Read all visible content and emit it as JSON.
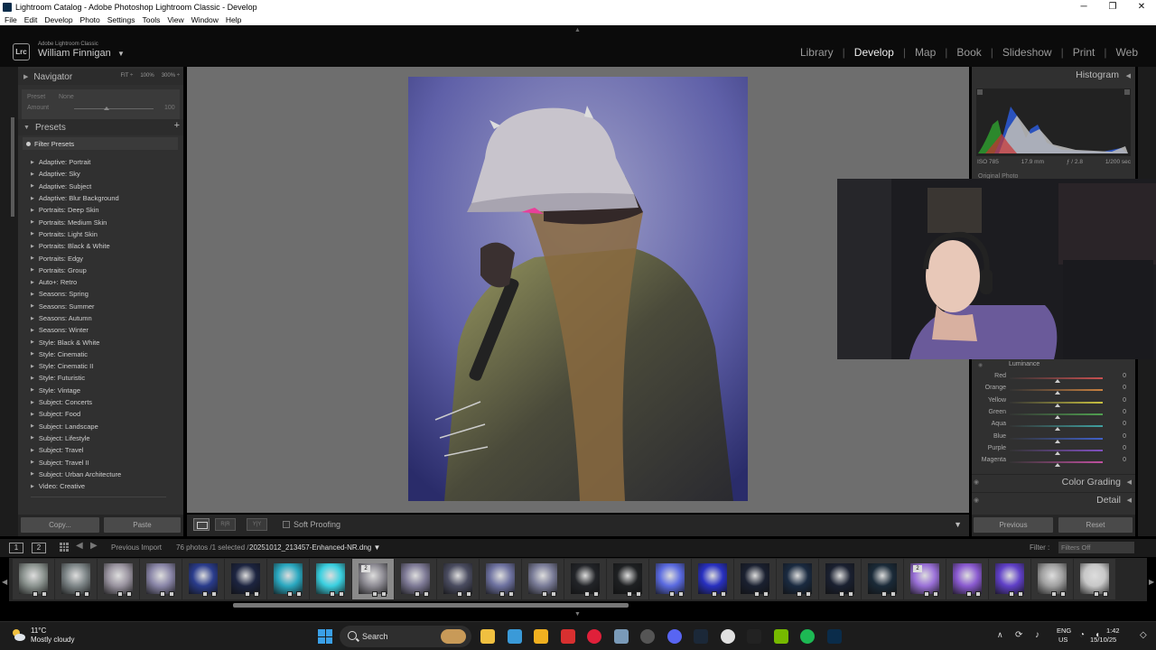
{
  "window": {
    "title": "Lightroom Catalog - Adobe Photoshop Lightroom Classic - Develop",
    "minimize": "─",
    "maximize": "❐",
    "close": "✕"
  },
  "menu": [
    "File",
    "Edit",
    "Develop",
    "Photo",
    "Settings",
    "Tools",
    "View",
    "Window",
    "Help"
  ],
  "identity": {
    "logo": "Lrc",
    "app_name": "Adobe Lightroom Classic",
    "user": "William Finnigan",
    "caret": "▼"
  },
  "modules": [
    "Library",
    "Develop",
    "Map",
    "Book",
    "Slideshow",
    "Print",
    "Web"
  ],
  "active_module": "Develop",
  "navigator": {
    "title": "Navigator",
    "zoom": [
      "FIT ÷",
      "100%",
      "300% ÷"
    ],
    "preset_label": "Preset",
    "preset_value": "None",
    "amount_label": "Amount",
    "amount_value": "100"
  },
  "presets": {
    "title": "Presets",
    "add": "+",
    "filter_label": "Filter Presets",
    "items": [
      "Adaptive: Portrait",
      "Adaptive: Sky",
      "Adaptive: Subject",
      "Adaptive: Blur Background",
      "Portraits: Deep Skin",
      "Portraits: Medium Skin",
      "Portraits: Light Skin",
      "Portraits: Black & White",
      "Portraits: Edgy",
      "Portraits: Group",
      "Auto+: Retro",
      "Seasons: Spring",
      "Seasons: Summer",
      "Seasons: Autumn",
      "Seasons: Winter",
      "Style: Black & White",
      "Style: Cinematic",
      "Style: Cinematic II",
      "Style: Futuristic",
      "Style: Vintage",
      "Subject: Concerts",
      "Subject: Food",
      "Subject: Landscape",
      "Subject: Lifestyle",
      "Subject: Travel",
      "Subject: Travel II",
      "Subject: Urban Architecture",
      "Video: Creative"
    ]
  },
  "left_buttons": {
    "copy": "Copy...",
    "paste": "Paste"
  },
  "toolbar": {
    "soft_proofing": "Soft Proofing",
    "ba": "R|R",
    "yy": "Y|Y",
    "caret": "▼"
  },
  "histogram": {
    "title": "Histogram",
    "exif": [
      "ISO 785",
      "17.9 mm",
      "ƒ / 2.8",
      "1/200 sec"
    ],
    "original_photo": "Original Photo"
  },
  "luminance": {
    "title": "Luminance",
    "rows": [
      {
        "label": "Red",
        "value": "0",
        "color": "#c85050"
      },
      {
        "label": "Orange",
        "value": "0",
        "color": "#c88040"
      },
      {
        "label": "Yellow",
        "value": "0",
        "color": "#c8c040"
      },
      {
        "label": "Green",
        "value": "0",
        "color": "#50a050"
      },
      {
        "label": "Aqua",
        "value": "0",
        "color": "#40a0a0"
      },
      {
        "label": "Blue",
        "value": "0",
        "color": "#4060c8"
      },
      {
        "label": "Purple",
        "value": "0",
        "color": "#8050c0"
      },
      {
        "label": "Magenta",
        "value": "0",
        "color": "#c050a0"
      }
    ]
  },
  "panels": {
    "color_grading": "Color Grading",
    "detail": "Detail"
  },
  "right_buttons": {
    "previous": "Previous",
    "reset": "Reset"
  },
  "filmbar": {
    "screen1": "1",
    "screen2": "2",
    "previous_import": "Previous Import",
    "count": "76 photos /1 selected /",
    "filename": "20251012_213457-Enhanced-NR.dng ▼",
    "filter_label": "Filter :",
    "filter_value": "Filters Off"
  },
  "thumbnails": [
    {
      "color": "#8c9490",
      "stack": ""
    },
    {
      "color": "#7e8688",
      "stack": ""
    },
    {
      "color": "#9a94a0",
      "stack": ""
    },
    {
      "color": "#8a86a8",
      "stack": ""
    },
    {
      "color": "#2a3c8c",
      "stack": ""
    },
    {
      "color": "#1c2440",
      "stack": ""
    },
    {
      "color": "#2aa8c0",
      "stack": ""
    },
    {
      "color": "#3ad0e0",
      "stack": ""
    },
    {
      "color": "#8e8c94",
      "stack": "2",
      "selected": true
    },
    {
      "color": "#7e7a96",
      "stack": ""
    },
    {
      "color": "#4a4c60",
      "stack": ""
    },
    {
      "color": "#6e72a0",
      "stack": ""
    },
    {
      "color": "#7a7c98",
      "stack": ""
    },
    {
      "color": "#222428",
      "stack": ""
    },
    {
      "color": "#1e2022",
      "stack": ""
    },
    {
      "color": "#5a6ae0",
      "stack": ""
    },
    {
      "color": "#2830c0",
      "stack": ""
    },
    {
      "color": "#1a2030",
      "stack": ""
    },
    {
      "color": "#1a2a40",
      "stack": ""
    },
    {
      "color": "#1a2030",
      "stack": ""
    },
    {
      "color": "#1a2a38",
      "stack": ""
    },
    {
      "color": "#9a70d8",
      "stack": "2"
    },
    {
      "color": "#8a5ad0",
      "stack": ""
    },
    {
      "color": "#6040c8",
      "stack": ""
    },
    {
      "color": "#a0a0a0",
      "stack": ""
    },
    {
      "color": "#c8c8c8",
      "stack": ""
    }
  ],
  "taskbar": {
    "temp": "11°C",
    "sky": "Mostly cloudy",
    "search": "Search",
    "lang1": "ENG",
    "lang2": "US",
    "time": "1:42",
    "date": "15/10/25",
    "icons": [
      "file-explorer-icon",
      "photos-icon",
      "folder-icon",
      "news-icon",
      "opera-icon",
      "nvidia-broadcast-icon",
      "obs-icon",
      "discord-icon",
      "steam-icon",
      "chrome-icon",
      "ghub-icon",
      "nvidia-icon",
      "spotify-icon",
      "lightroom-icon"
    ]
  }
}
